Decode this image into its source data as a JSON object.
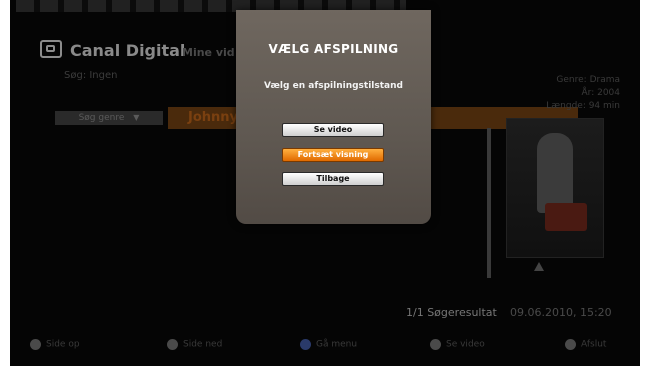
{
  "header": {
    "brand": "Canal Digital",
    "section": "Mine vid",
    "search_label": "Søg: Ingen"
  },
  "search_row": {
    "genre_button": "Søg genre",
    "genre_arrow_icon": "triangle-down",
    "result_title": "Johnny"
  },
  "info": {
    "genre": "Genre: Drama",
    "year": "År: 2004",
    "length": "Længde: 94 min",
    "rating_icon": "rating-icon"
  },
  "status": {
    "result_count": "1/1 Søgeresultat",
    "datetime": "09.06.2010, 15:20"
  },
  "dialog": {
    "title": "VÆLG AFSPILNING",
    "subtitle": "Vælg en afspilningstilstand",
    "buttons": [
      "Se video",
      "Fortsæt visning",
      "Tilbage"
    ],
    "selected_index": 1
  },
  "hints": [
    {
      "label": "Side op",
      "color": "#4a4a4a"
    },
    {
      "label": "Side ned",
      "color": "#4a4a4a"
    },
    {
      "label": "Gå menu",
      "color": "#2a3a6a"
    },
    {
      "label": "Se video",
      "color": "#4a4a4a"
    },
    {
      "label": "Afslut",
      "color": "#4a4a4a"
    }
  ],
  "colors": {
    "highlight": "#f08a10",
    "dialog_bg": "#665f58",
    "background": "#050505"
  }
}
